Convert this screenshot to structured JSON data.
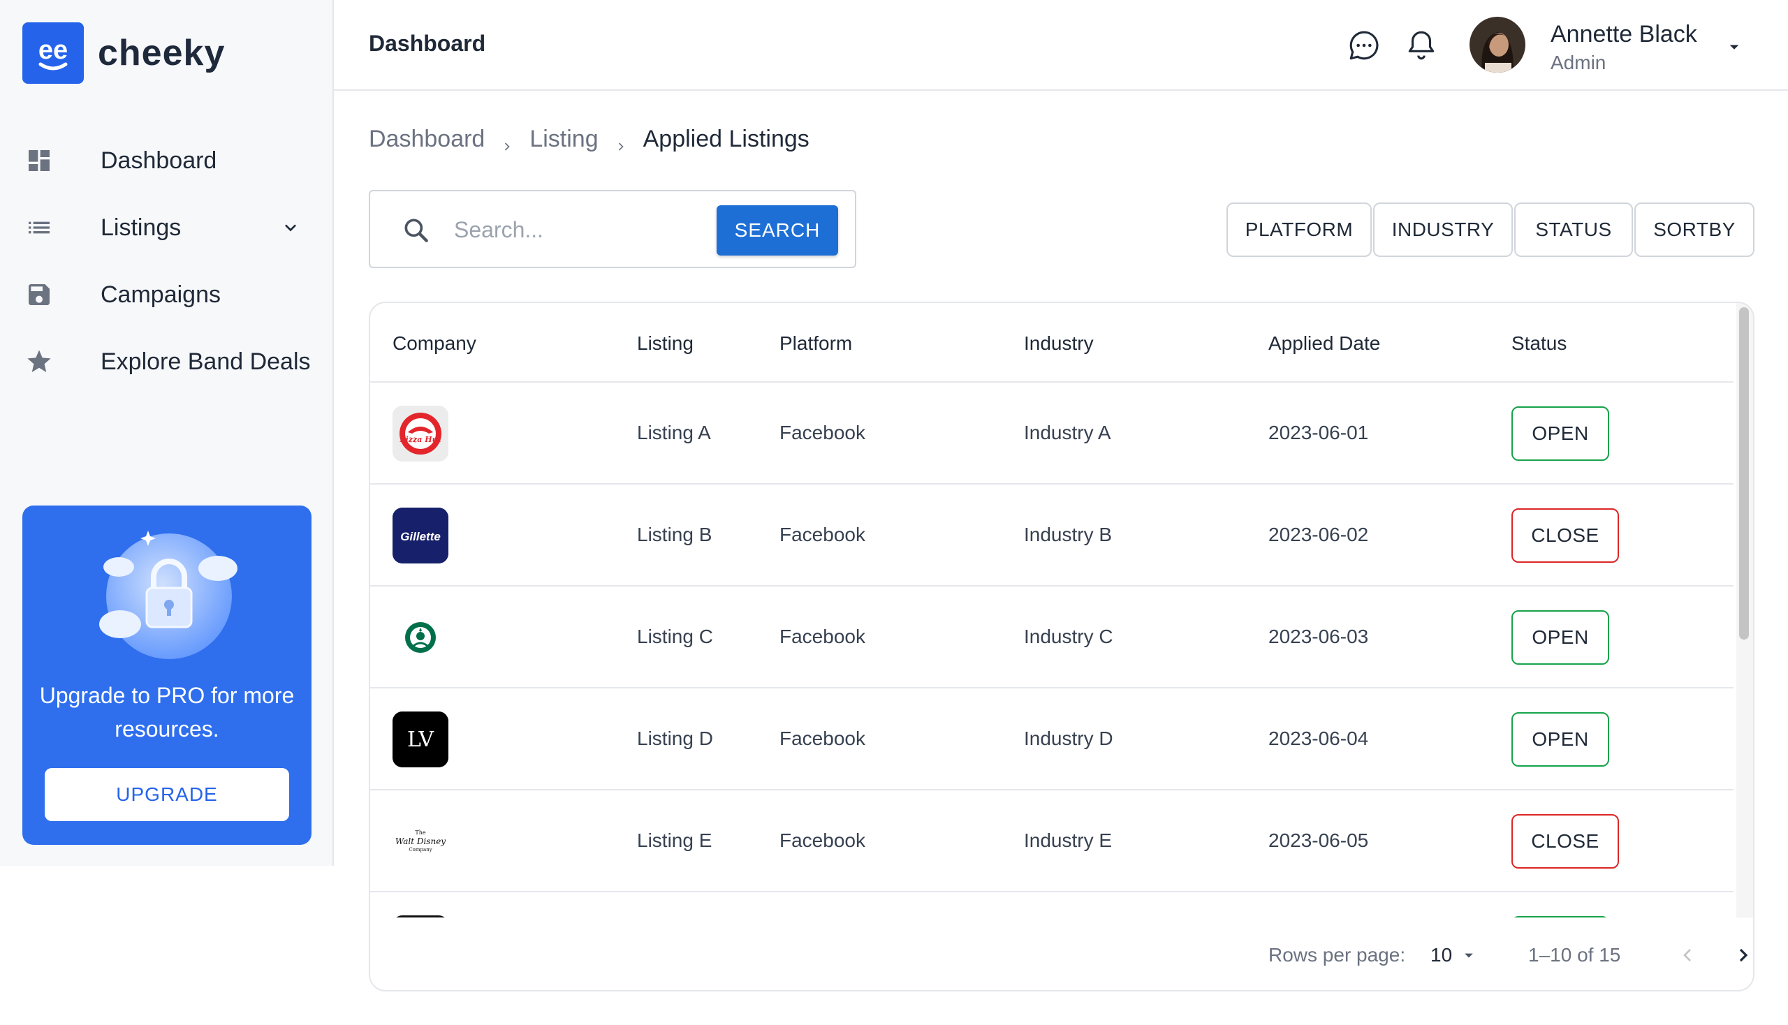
{
  "app": {
    "name": "cheeky",
    "brand_color": "#2563eb"
  },
  "sidebar": {
    "items": [
      {
        "label": "Dashboard",
        "icon": "dashboard-icon"
      },
      {
        "label": "Listings",
        "icon": "list-icon",
        "expandable": true
      },
      {
        "label": "Campaigns",
        "icon": "save-icon"
      },
      {
        "label": "Explore Band Deals",
        "icon": "star-icon"
      }
    ],
    "promo": {
      "text": "Upgrade to PRO for more resources.",
      "button": "UPGRADE"
    }
  },
  "header": {
    "title": "Dashboard",
    "user": {
      "name": "Annette Black",
      "role": "Admin"
    }
  },
  "breadcrumb": [
    "Dashboard",
    "Listing",
    "Applied Listings"
  ],
  "search": {
    "placeholder": "Search...",
    "button": "SEARCH"
  },
  "filters": [
    "PLATFORM",
    "INDUSTRY",
    "STATUS",
    "SORTBY"
  ],
  "table": {
    "columns": [
      "Company",
      "Listing",
      "Platform",
      "Industry",
      "Applied Date",
      "Status"
    ],
    "rows": [
      {
        "company_logo": "pizza-hut-logo",
        "listing": "Listing A",
        "platform": "Facebook",
        "industry": "Industry A",
        "date": "2023-06-01",
        "status": "OPEN"
      },
      {
        "company_logo": "gillette-logo",
        "listing": "Listing B",
        "platform": "Facebook",
        "industry": "Industry B",
        "date": "2023-06-02",
        "status": "CLOSE"
      },
      {
        "company_logo": "starbucks-logo",
        "listing": "Listing C",
        "platform": "Facebook",
        "industry": "Industry C",
        "date": "2023-06-03",
        "status": "OPEN"
      },
      {
        "company_logo": "louis-vuitton-logo",
        "listing": "Listing D",
        "platform": "Facebook",
        "industry": "Industry D",
        "date": "2023-06-04",
        "status": "OPEN"
      },
      {
        "company_logo": "walt-disney-logo",
        "listing": "Listing E",
        "platform": "Facebook",
        "industry": "Industry E",
        "date": "2023-06-05",
        "status": "CLOSE"
      }
    ],
    "status_colors": {
      "OPEN": "#16a34a",
      "CLOSE": "#dc2626"
    }
  },
  "pagination": {
    "rows_per_page_label": "Rows per page:",
    "rows_per_page": "10",
    "range": "1–10 of 15"
  },
  "logo_text": {
    "gillette": "Gillette",
    "pizza_hut": "Pizza Hut",
    "lv": "LV",
    "disney_top": "The",
    "disney_main": "Walt Disney",
    "disney_bottom": "Company"
  }
}
